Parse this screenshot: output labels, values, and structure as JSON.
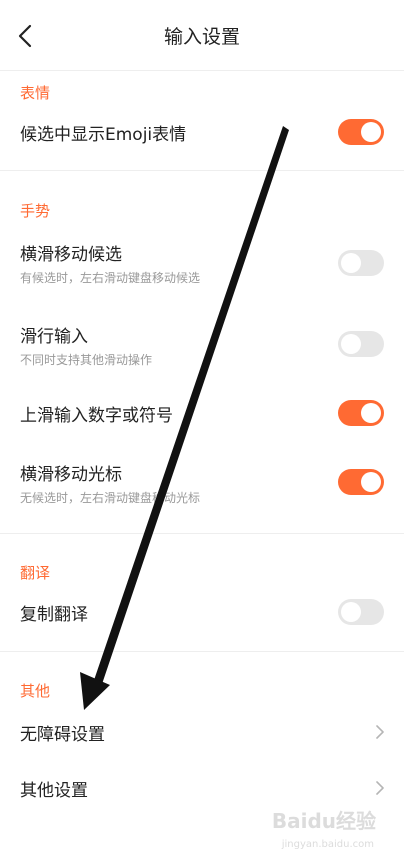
{
  "header": {
    "title": "输入设置",
    "back_icon": "chevron-left-icon"
  },
  "sections": {
    "emoji": {
      "label": "表情"
    },
    "gesture": {
      "label": "手势"
    },
    "translate": {
      "label": "翻译"
    },
    "other": {
      "label": "其他"
    }
  },
  "items": {
    "emoji_candidates": {
      "title": "候选中显示Emoji表情",
      "enabled": true
    },
    "swipe_candidates": {
      "title": "横滑移动候选",
      "subtitle": "有候选时，左右滑动键盘移动候选",
      "enabled": false
    },
    "glide_input": {
      "title": "滑行输入",
      "subtitle": "不同时支持其他滑动操作",
      "enabled": false
    },
    "swipe_up_numbers": {
      "title": "上滑输入数字或符号",
      "enabled": true
    },
    "swipe_cursor": {
      "title": "横滑移动光标",
      "subtitle": "无候选时，左右滑动键盘移动光标",
      "enabled": true
    },
    "copy_translate": {
      "title": "复制翻译",
      "enabled": false
    },
    "accessibility": {
      "title": "无障碍设置"
    },
    "other_settings": {
      "title": "其他设置"
    }
  },
  "watermark": {
    "text": "Baidu经验",
    "sub": "jingyan.baidu.com"
  },
  "colors": {
    "accent": "#ff6a33",
    "toggle_off": "#e6e6e6"
  }
}
